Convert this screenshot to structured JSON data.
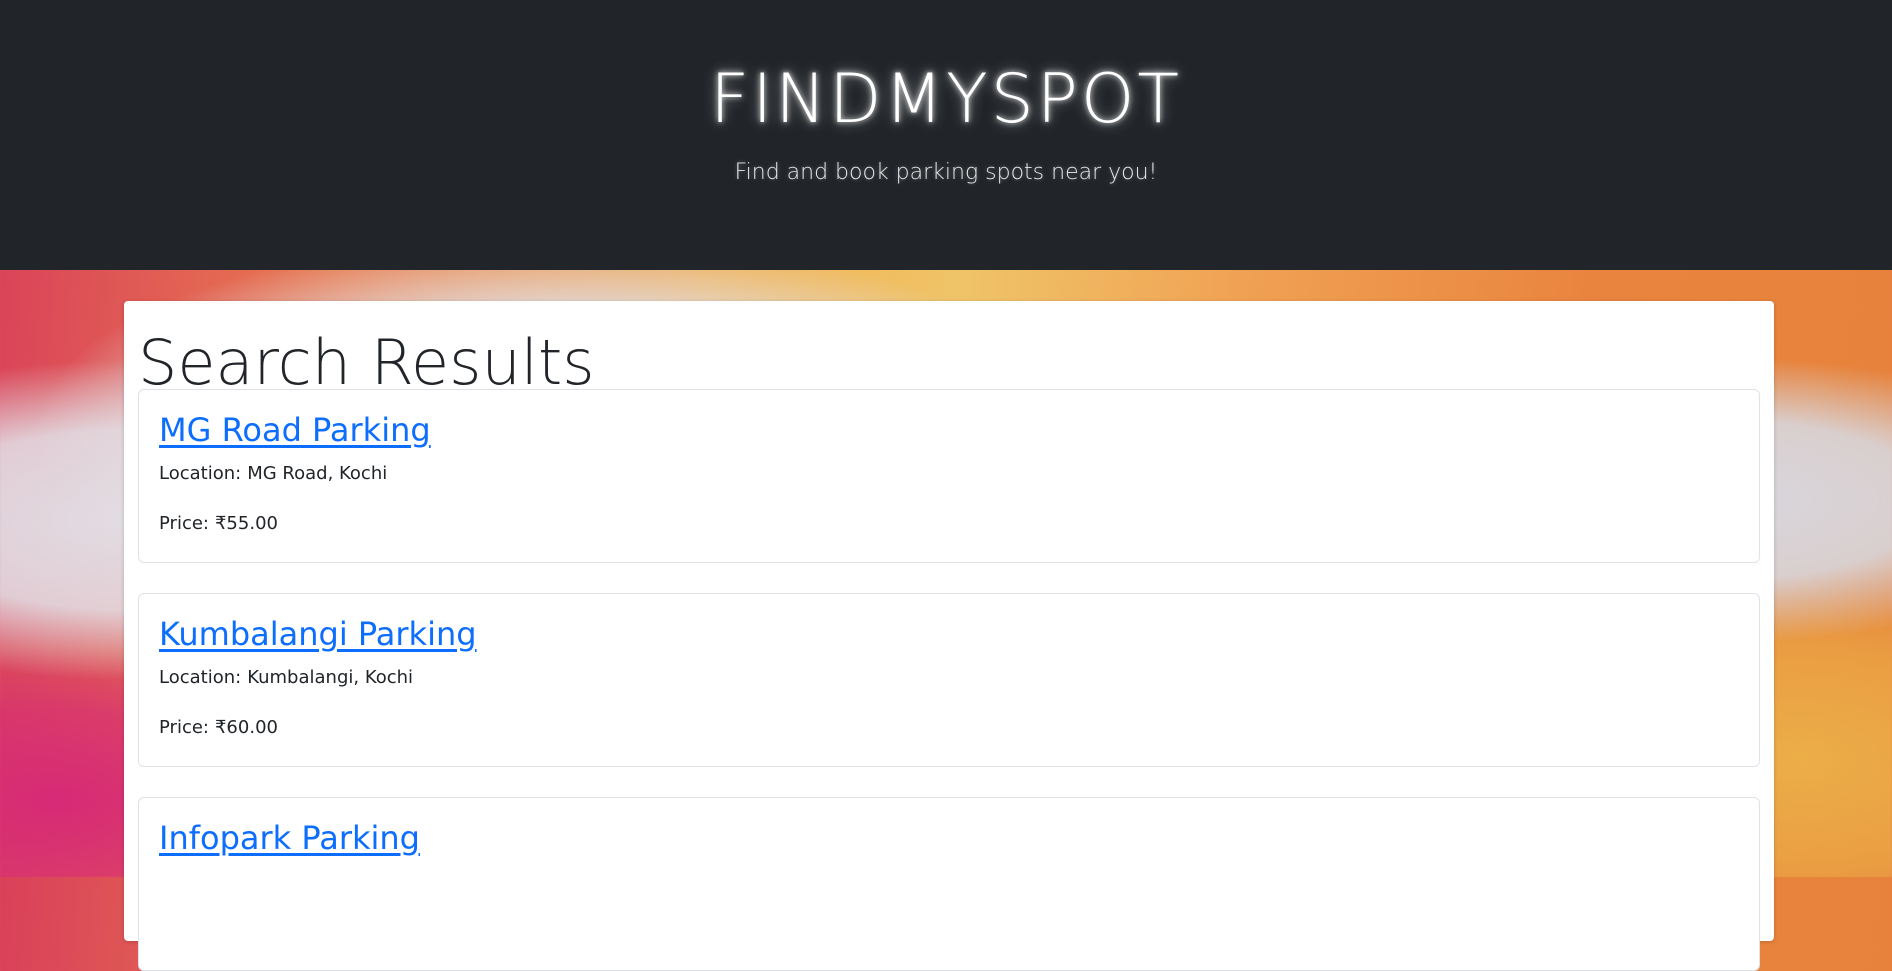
{
  "header": {
    "brand": "FINDMYSPOT",
    "tagline": "Find and book parking spots near you!"
  },
  "results": {
    "title": "Search Results",
    "location_label": "Location:",
    "price_label": "Price:",
    "items": [
      {
        "name": "MG Road Parking",
        "location": "MG Road, Kochi",
        "price": "₹55.00"
      },
      {
        "name": "Kumbalangi Parking",
        "location": "Kumbalangi, Kochi",
        "price": "₹60.00"
      },
      {
        "name": "Infopark Parking",
        "location": "",
        "price": ""
      }
    ]
  },
  "colors": {
    "header_bg": "#212529",
    "link": "#0d6efd",
    "card_border": "#dee2e6"
  }
}
